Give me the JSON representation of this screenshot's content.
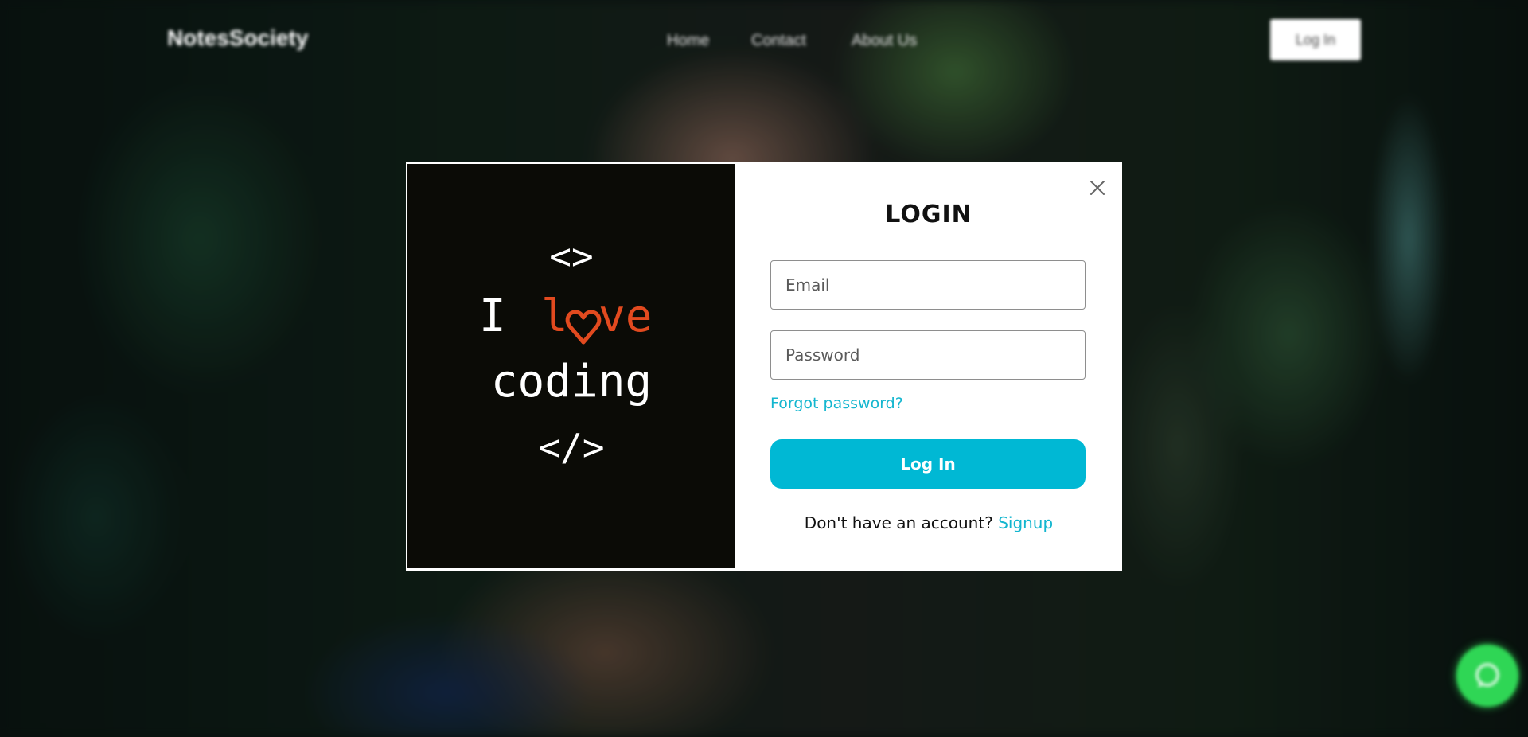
{
  "navbar": {
    "brand": "NotesSociety",
    "links": [
      "Home",
      "Contact",
      "About Us"
    ],
    "login_button": "Log In"
  },
  "modal": {
    "image": {
      "line1": "<>",
      "line2_prefix": "I ",
      "line2_highlight": "l",
      "line2_suffix": "ve",
      "line3": "coding",
      "line4": "</>",
      "text_color": "#ffffff",
      "accent_color": "#e24a1f"
    },
    "title": "LOGIN",
    "email_placeholder": "Email",
    "password_placeholder": "Password",
    "forgot_password": "Forgot password?",
    "login_button": "Log In",
    "signup_prompt": "Don't have an account?",
    "signup_link": "Signup",
    "accent_color": "#00b8d4"
  },
  "fab": {
    "icon": "chat-icon",
    "color": "#2fd655"
  }
}
